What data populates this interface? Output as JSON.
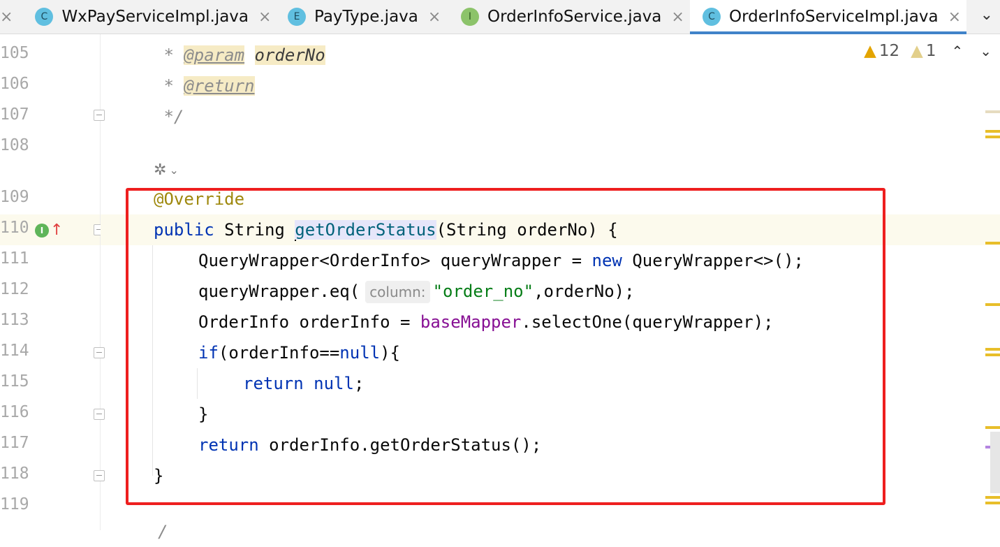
{
  "tabs": [
    {
      "badge": "C",
      "label": "WxPayServiceImpl.java",
      "active": false
    },
    {
      "badge": "E",
      "label": "PayType.java",
      "active": false
    },
    {
      "badge": "I",
      "label": "OrderInfoService.java",
      "active": false
    },
    {
      "badge": "C",
      "label": "OrderInfoServiceImpl.java",
      "active": true
    }
  ],
  "tab_close_glyph": "×",
  "tab_menu_glyph": "⌄",
  "inspections": {
    "warnings": "12",
    "weak_warnings": "1"
  },
  "line_numbers": [
    "105",
    "106",
    "107",
    "108",
    "109",
    "110",
    "111",
    "112",
    "113",
    "114",
    "115",
    "116",
    "117",
    "118",
    "119"
  ],
  "gutter_icons": {
    "implements_badge": "I",
    "implements_arrow": "↑"
  },
  "code": {
    "l105_star": " * ",
    "l105_tag": "@param",
    "l105_param": "orderNo",
    "l106_star": " * ",
    "l106_tag": "@return",
    "l107": " */",
    "l109": "@Override",
    "l110_kw": "public",
    "l110_type": " String ",
    "l110_method": "getOrderStatus",
    "l110_rest": "(String orderNo) {",
    "l111_a": "QueryWrapper<OrderInfo> queryWrapper = ",
    "l111_kw": "new",
    "l111_b": " QueryWrapper<>();",
    "l112_a": "queryWrapper.eq(",
    "l112_hint": "column:",
    "l112_str": "\"order_no\"",
    "l112_b": ",orderNo);",
    "l113_a": "OrderInfo orderInfo = ",
    "l113_field": "baseMapper",
    "l113_b": ".selectOne(queryWrapper);",
    "l114_kw": "if",
    "l114_a": "(orderInfo==",
    "l114_kw2": "null",
    "l114_b": "){",
    "l115_kw": "return",
    "l115_kw2": " null",
    "l115_b": ";",
    "l116": "}",
    "l117_kw": "return",
    "l117_b": " orderInfo.getOrderStatus();",
    "l118": "}",
    "l120_partial": "/"
  },
  "colors": {
    "keyword": "#0033b3",
    "string": "#067d17",
    "annotation": "#9e880d",
    "field": "#871094",
    "highlight_box": "#ee1f1f",
    "active_tab_underline": "#4083c9"
  }
}
